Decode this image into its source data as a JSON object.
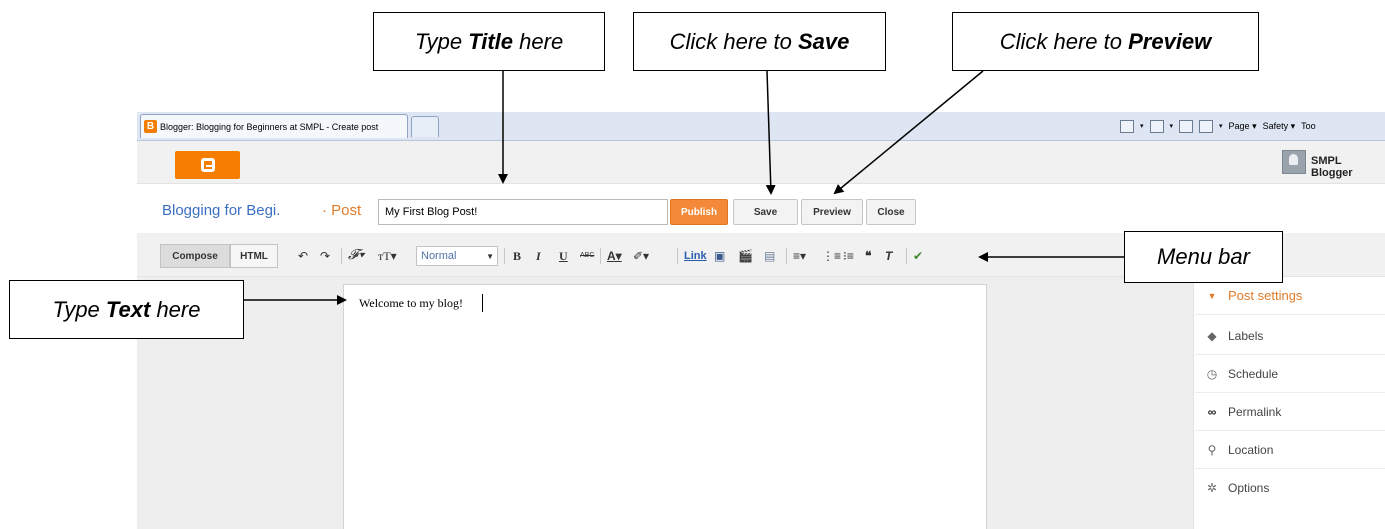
{
  "callouts": {
    "title_pre": "Type ",
    "title_bold": "Title",
    "title_post": " here",
    "save_pre": "Click here to ",
    "save_bold": "Save",
    "preview_pre": "Click here to ",
    "preview_bold": "Preview",
    "text_pre": "Type ",
    "text_bold": "Text",
    "text_post": " here",
    "menu_bar": "Menu bar"
  },
  "browser": {
    "tab_title": "Blogger: Blogging for Beginners at SMPL - Create post",
    "tab_icon_glyph": "B",
    "toolbar_page": "Page",
    "toolbar_safety": "Safety",
    "toolbar_tools": "Too"
  },
  "header": {
    "user_name": "SMPL Blogger"
  },
  "post": {
    "blog_name": "Blogging for Begi.",
    "crumb": "· Post",
    "title_value": "My First Blog Post!",
    "publish_label": "Publish",
    "save_label": "Save",
    "preview_label": "Preview",
    "close_label": "Close"
  },
  "editor": {
    "compose_tab": "Compose",
    "html_tab": "HTML",
    "format_value": "Normal",
    "link_label": "Link",
    "body_text": "Welcome to my blog!"
  },
  "sidebar": {
    "items": [
      {
        "label": "Post settings",
        "icon": "caret-down-icon"
      },
      {
        "label": "Labels",
        "icon": "tag-icon"
      },
      {
        "label": "Schedule",
        "icon": "clock-icon"
      },
      {
        "label": "Permalink",
        "icon": "link-icon"
      },
      {
        "label": "Location",
        "icon": "pin-icon"
      },
      {
        "label": "Options",
        "icon": "gear-icon"
      }
    ]
  },
  "colors": {
    "blogger_orange": "#f57d00",
    "publish_orange": "#f48a39",
    "link_blue": "#3b6fc4",
    "accent_orange_text": "#e07b2a"
  }
}
